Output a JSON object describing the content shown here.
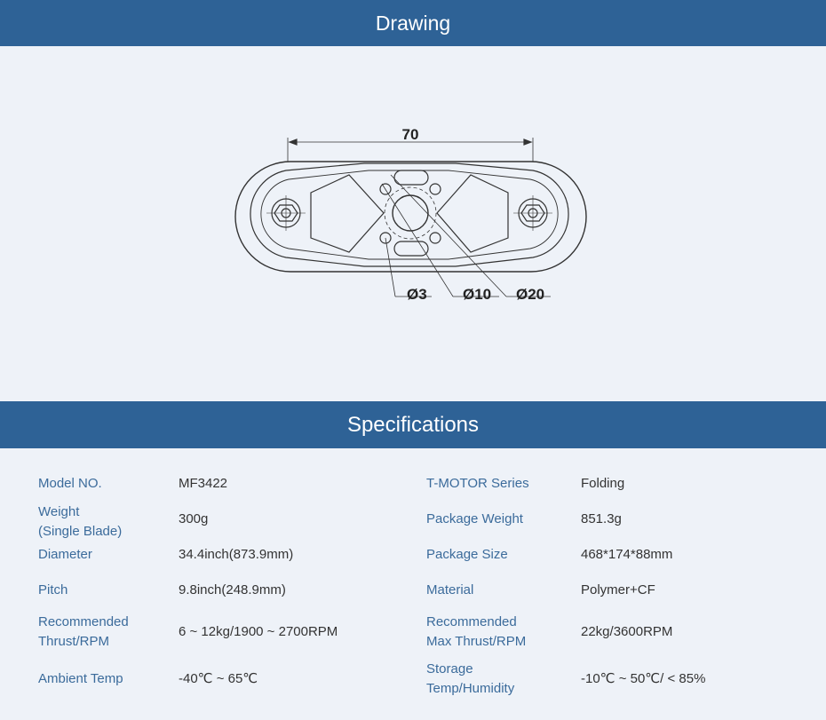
{
  "drawing_section": {
    "title": "Drawing"
  },
  "drawing": {
    "dim_width": "70",
    "hole_labels": [
      "Ø3",
      "Ø10",
      "Ø20"
    ]
  },
  "specs_section": {
    "title": "Specifications"
  },
  "specs": {
    "left": [
      {
        "label": [
          "Model NO."
        ],
        "value": "MF3422"
      },
      {
        "label": [
          "Weight",
          "(Single Blade)"
        ],
        "value": "300g"
      },
      {
        "label": [
          "Diameter"
        ],
        "value": "34.4inch(873.9mm)"
      },
      {
        "label": [
          "Pitch"
        ],
        "value": "9.8inch(248.9mm)"
      },
      {
        "label": [
          "Recommended",
          "Thrust/RPM"
        ],
        "value": "6 ~ 12kg/1900 ~ 2700RPM"
      },
      {
        "label": [
          "Ambient Temp"
        ],
        "value": "-40℃ ~ 65℃"
      }
    ],
    "right": [
      {
        "label": [
          "T-MOTOR Series"
        ],
        "value": "Folding"
      },
      {
        "label": [
          "Package Weight"
        ],
        "value": "851.3g"
      },
      {
        "label": [
          "Package Size"
        ],
        "value": "468*174*88mm"
      },
      {
        "label": [
          "Material"
        ],
        "value": "Polymer+CF"
      },
      {
        "label": [
          "Recommended",
          "Max Thrust/RPM"
        ],
        "value": "22kg/3600RPM"
      },
      {
        "label": [
          "Storage",
          "Temp/Humidity"
        ],
        "value": "-10℃ ~ 50℃/ < 85%"
      }
    ]
  },
  "colors": {
    "header_bg": "#2e6296",
    "label": "#3b6b9b",
    "value": "#333333",
    "page_bg": "#eef2f8"
  }
}
